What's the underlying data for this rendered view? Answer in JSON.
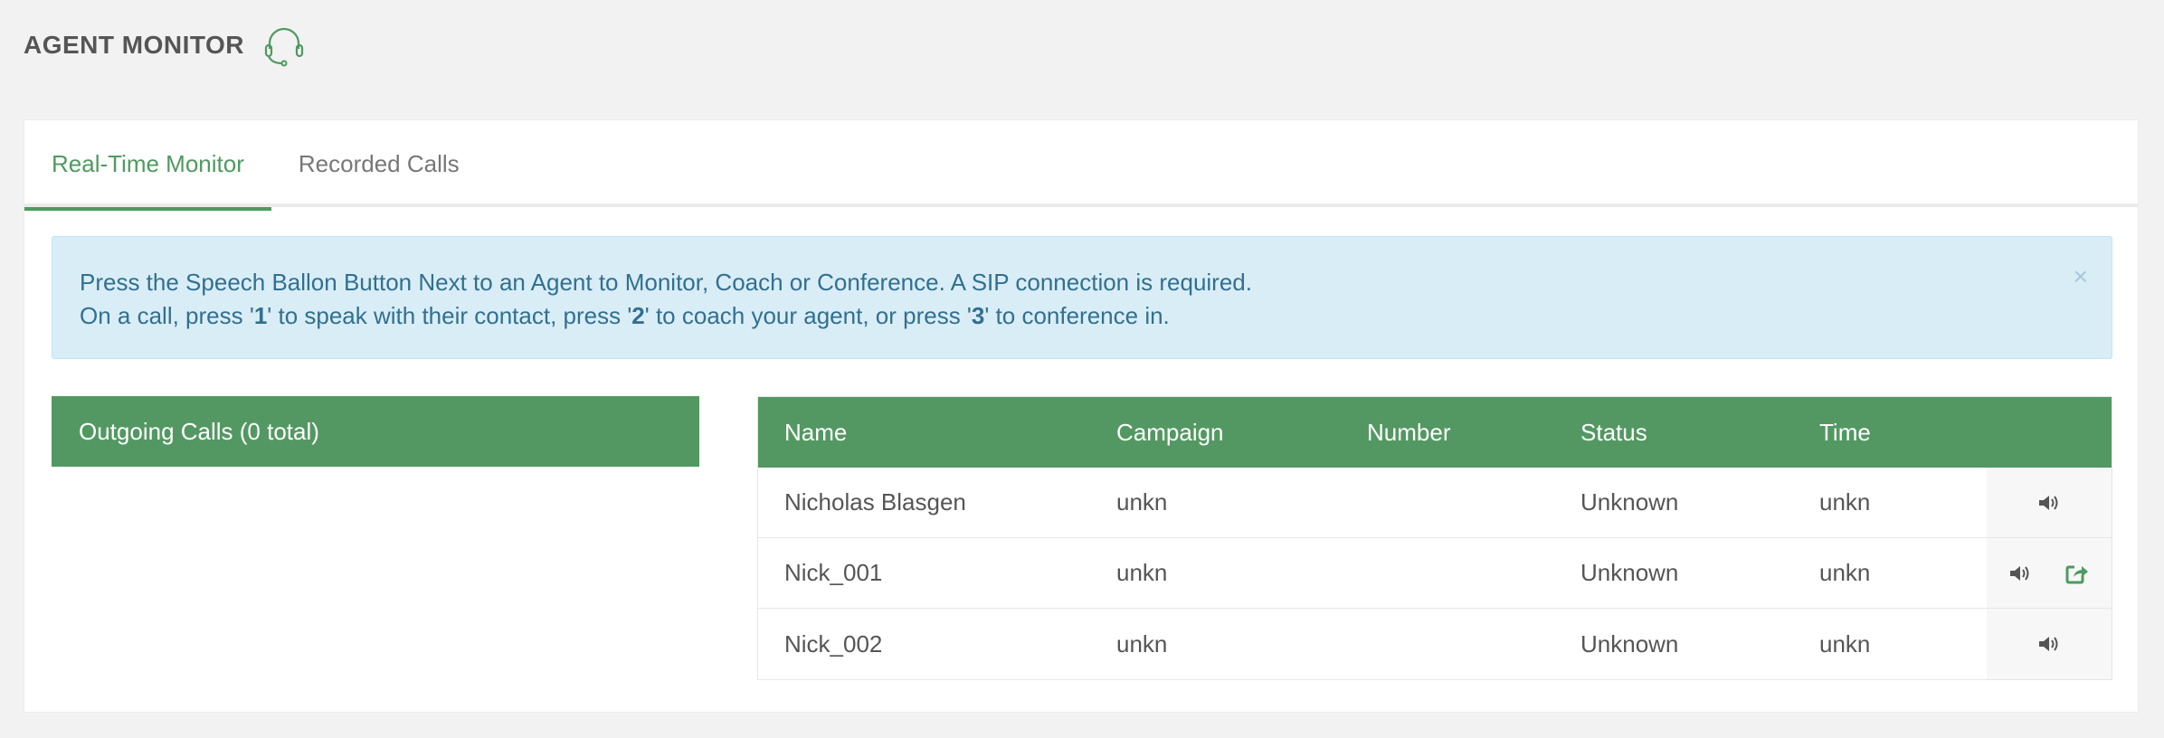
{
  "header": {
    "title": "AGENT MONITOR",
    "icon": "headset-icon"
  },
  "tabs": [
    {
      "label": "Real-Time Monitor",
      "active": true
    },
    {
      "label": "Recorded Calls",
      "active": false
    }
  ],
  "alert": {
    "line1": "Press the Speech Ballon Button Next to an Agent to Monitor, Coach or Conference. A SIP connection is required.",
    "line2_a": "On a call, press '",
    "key1": "1",
    "line2_b": "' to speak with their contact, press '",
    "key2": "2",
    "line2_c": "' to coach your agent, or press '",
    "key3": "3",
    "line2_d": "' to conference in.",
    "close": "×"
  },
  "outgoing": {
    "label": "Outgoing Calls (0 total)"
  },
  "agents_table": {
    "columns": [
      "Name",
      "Campaign",
      "Number",
      "Status",
      "Time"
    ],
    "rows": [
      {
        "name": "Nicholas Blasgen",
        "campaign": "unkn",
        "number": "",
        "status": "Unknown",
        "time": "unkn",
        "actions": [
          "speaker-icon"
        ]
      },
      {
        "name": "Nick_001",
        "campaign": "unkn",
        "number": "",
        "status": "Unknown",
        "time": "unkn",
        "actions": [
          "speaker-icon",
          "share-icon"
        ]
      },
      {
        "name": "Nick_002",
        "campaign": "unkn",
        "number": "",
        "status": "Unknown",
        "time": "unkn",
        "actions": [
          "speaker-icon"
        ]
      }
    ]
  },
  "colors": {
    "accent": "#4e9a5f",
    "table_header": "#539862",
    "alert_bg": "#d9edf7",
    "alert_text": "#31708f"
  }
}
